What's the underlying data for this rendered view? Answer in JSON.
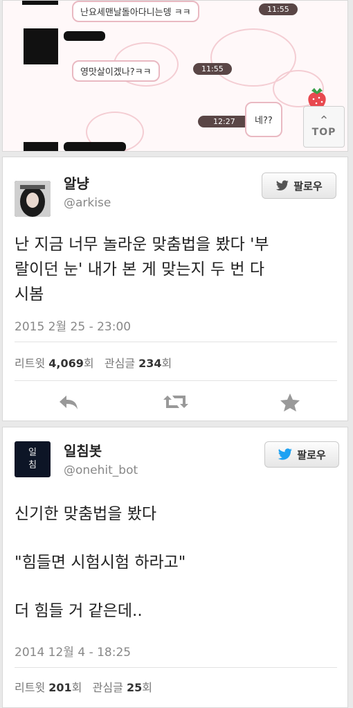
{
  "chat": {
    "messages": [
      {
        "text": "난요세맨날돌아다니는뎅 ㅋㅋ",
        "time": "11:55"
      },
      {
        "text": "영맛살이겠나?ㅋㅋ",
        "time": "11:55"
      },
      {
        "text": "네??",
        "time": "12:27"
      }
    ],
    "top_button": "TOP"
  },
  "tweets": [
    {
      "name": "알냥",
      "handle": "@arkise",
      "follow_label": "팔로우",
      "text_lines": [
        "난 지금 너무 놀라운 맞춤법을 봤다 '부",
        "랄이던 눈' 내가 본 게 맞는지 두 번 다",
        "시봄"
      ],
      "date": "2015 2월 25 - 23:00",
      "retweet_label": "리트윗",
      "retweet_count": "4,069",
      "retweet_unit": "회",
      "fav_label": "관심글",
      "fav_count": "234",
      "fav_unit": "회"
    },
    {
      "name": "일침봇",
      "handle": "@onehit_bot",
      "follow_label": "팔로우",
      "avatar_chars": [
        "일",
        "침"
      ],
      "text_lines": [
        "신기한 맞춤법을 봤다",
        "",
        "\"힘들면 시험시험 하라고\"",
        "",
        "더 힘들 거 같은데.."
      ],
      "date": "2014 12월 4 - 18:25",
      "retweet_label": "리트윗",
      "retweet_count": "201",
      "retweet_unit": "회",
      "fav_label": "관심글",
      "fav_count": "25",
      "fav_unit": "회"
    }
  ],
  "colors": {
    "twitter_blue": "#1da1f2",
    "chat_time_bg": "#5a4646",
    "bubble_border": "#e9b9c2"
  },
  "icons": [
    "twitter-bird-icon",
    "reply-icon",
    "retweet-icon",
    "favorite-star-icon",
    "chevron-up-icon",
    "strawberry-icon"
  ]
}
